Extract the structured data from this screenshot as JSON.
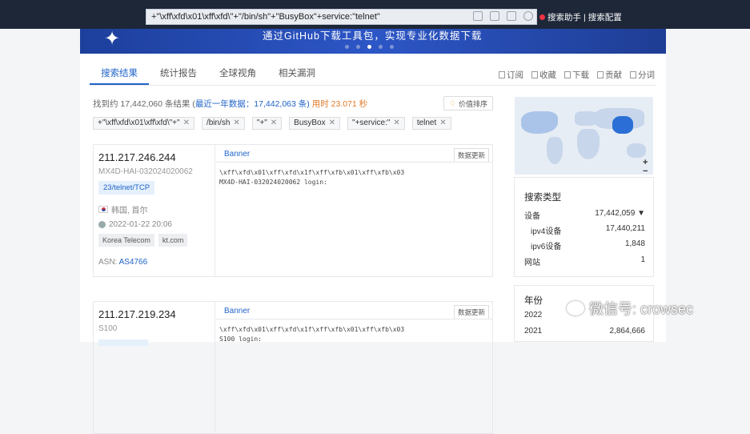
{
  "search": {
    "query": "+\"\\xff\\xfd\\x01\\xff\\xfd\\\"+\"/bin/sh\"+\"BusyBox\"+service:\"telnet\""
  },
  "toplinks": {
    "assistant": "搜索助手",
    "sep": "|",
    "config": "搜索配置"
  },
  "banner": {
    "text": "通过GitHub下载工具包，实现专业化数据下载"
  },
  "tabs": [
    {
      "label": "搜索结果"
    },
    {
      "label": "统计报告"
    },
    {
      "label": "全球视角"
    },
    {
      "label": "相关漏洞"
    }
  ],
  "actions": {
    "subscribe": "订阅",
    "favorite": "收藏",
    "download": "下载",
    "contribute": "贡献",
    "share": "分词"
  },
  "summary": {
    "prefix": "找到约 17,442,060 条结果 (",
    "recent": "最近一年数据",
    "recent_count": "：17,442,063 条)",
    "time": "用时 23.071 秒"
  },
  "sort_button": "价值排序",
  "chips": [
    "+\"\\xff\\xfd\\x01\\xff\\xfd\\\"+\"",
    "/bin/sh",
    "\"+\"",
    "BusyBox",
    "\"+service:\"",
    "telnet"
  ],
  "results": [
    {
      "ip": "211.217.246.244",
      "host": "MX4D-HAI-032024020062",
      "port": "23/telnet/TCP",
      "location": "韩国, 首尔",
      "date": "2022-01-22 20:06",
      "orgs": [
        "Korea Telecom",
        "kt.com"
      ],
      "asn_label": "ASN: ",
      "asn": "AS4766",
      "banner_label": "Banner",
      "update_label": "数据更新",
      "raw": "\\xff\\xfd\\x01\\xff\\xfd\\x1f\\xff\\xfb\\x01\\xff\\xfb\\x03\nMX4D-HAI-032024020062 login:"
    },
    {
      "ip": "211.217.219.234",
      "host": "S100",
      "banner_label": "Banner",
      "update_label": "数据更新",
      "raw": "\\xff\\xfd\\x01\\xff\\xfd\\x1f\\xff\\xfb\\x01\\xff\\xfb\\x03\nS100 login:"
    }
  ],
  "map": {
    "zoom_in": "+",
    "zoom_out": "−"
  },
  "search_type": {
    "title": "搜索类型",
    "rows": [
      {
        "label": "设备",
        "value": "17,442,059"
      },
      {
        "label": "ipv4设备",
        "value": "17,440,211"
      },
      {
        "label": "ipv6设备",
        "value": "1,848"
      },
      {
        "label": "网站",
        "value": "1"
      }
    ]
  },
  "year": {
    "title": "年份",
    "rows": [
      {
        "label": "2022",
        "value": ""
      },
      {
        "label": "2021",
        "value": "2,864,666"
      }
    ]
  },
  "watermark": "微信号: crowsec",
  "colors": {
    "accent": "#1f63c9",
    "topbar": "#1d2738",
    "time": "#e07a28"
  }
}
